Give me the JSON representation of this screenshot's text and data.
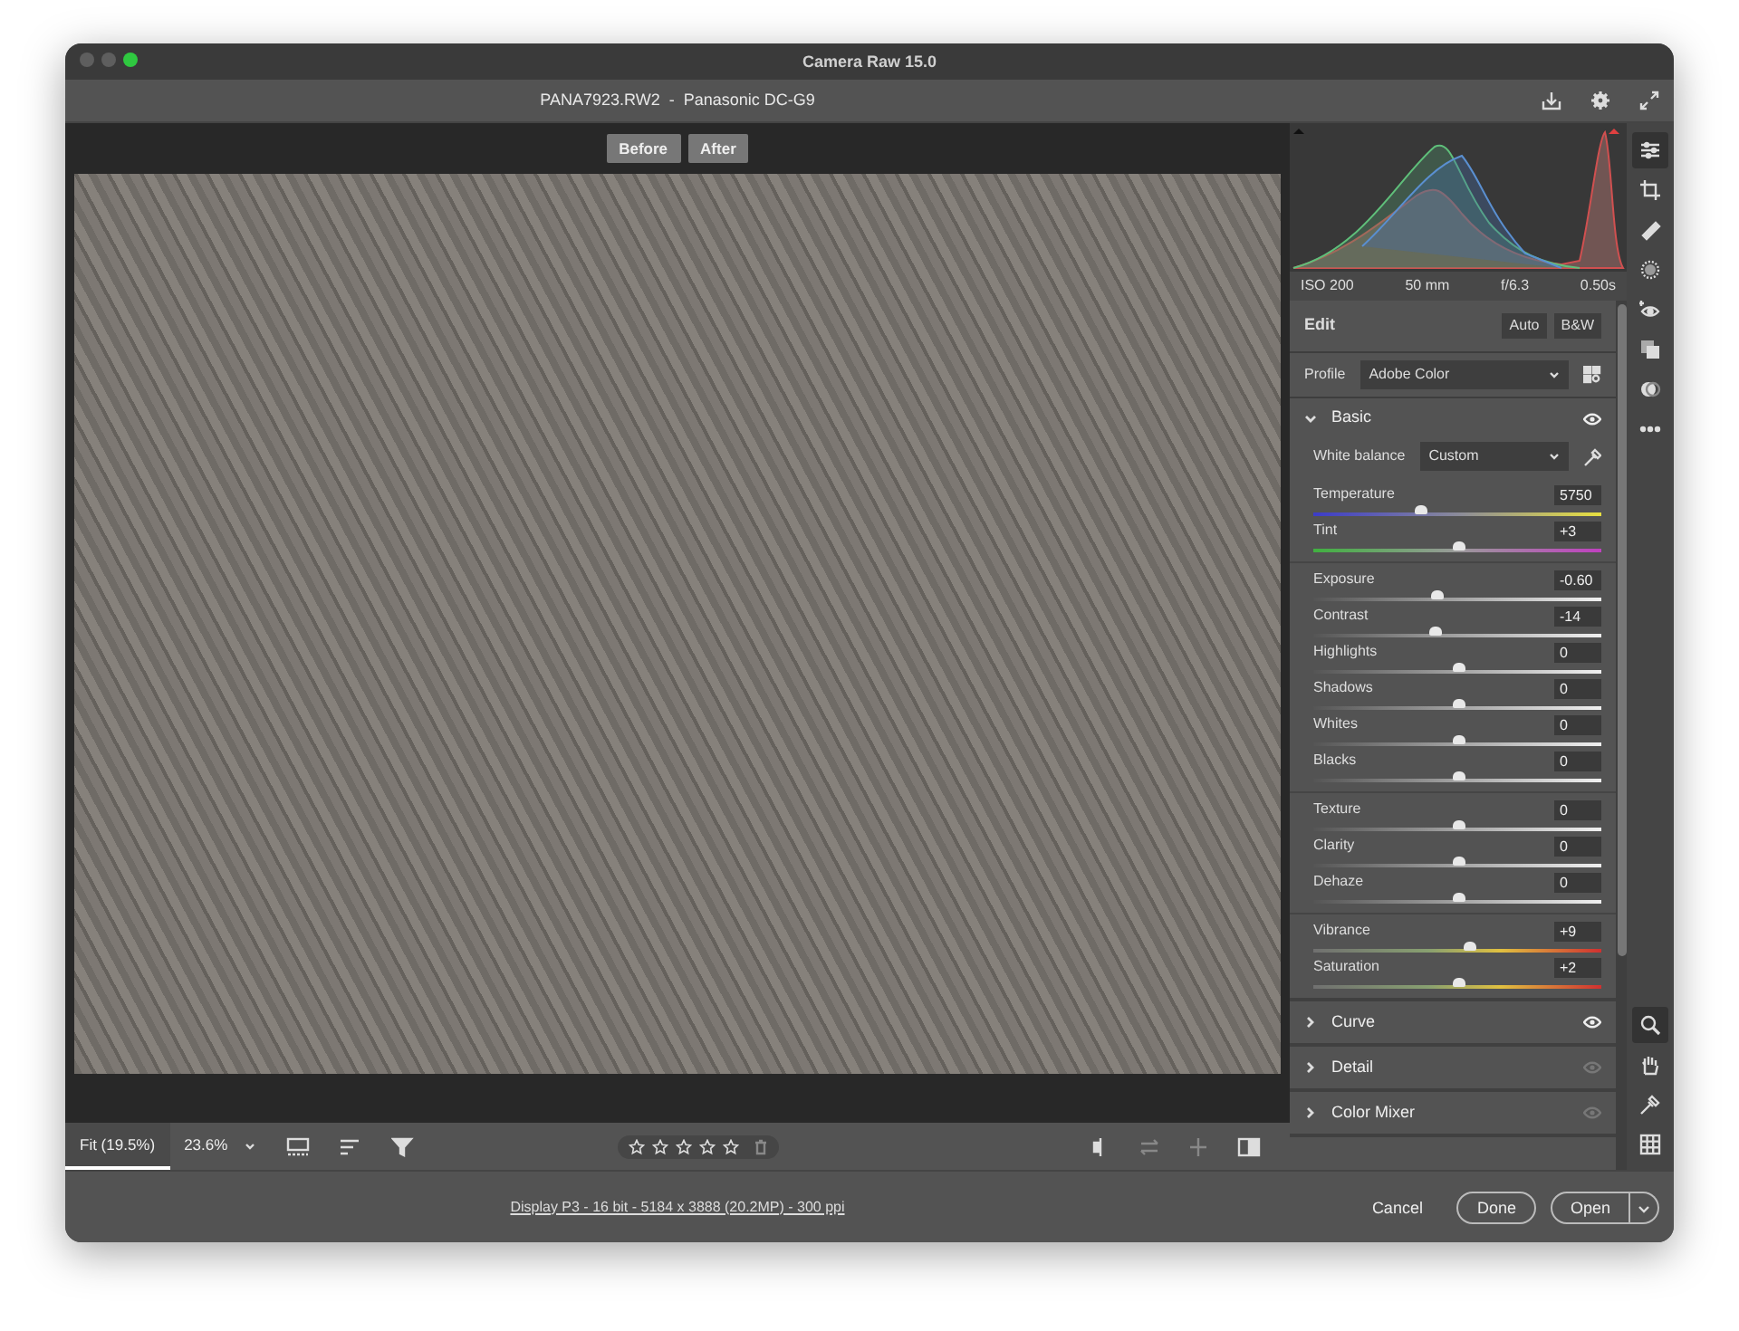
{
  "window": {
    "title": "Camera Raw 15.0"
  },
  "header": {
    "file": "PANA7923.RW2  -  Panasonic DC-G9"
  },
  "compare_buttons": [
    {
      "label": "Before"
    },
    {
      "label": "After"
    }
  ],
  "zoom_tabs": [
    {
      "label": "Fit (19.5%)",
      "selected": true
    },
    {
      "label": "23.6%",
      "selected": false
    }
  ],
  "rating": {
    "stars": 0
  },
  "histogram": {
    "info": [
      "ISO 200",
      "50 mm",
      "f/6.3",
      "0.50s"
    ]
  },
  "edit": {
    "title": "Edit",
    "buttons": [
      "Auto",
      "B&W"
    ]
  },
  "profile": {
    "label": "Profile",
    "value": "Adobe Color"
  },
  "basic": {
    "title": "Basic",
    "expanded": true,
    "active": true,
    "white_balance": {
      "label": "White balance",
      "value": "Custom"
    },
    "slider_groups": [
      [
        {
          "label": "Temperature",
          "value": "5750",
          "level": 0.37,
          "kind": "temperature"
        },
        {
          "label": "Tint",
          "value": "+3",
          "level": 0.5,
          "kind": "tint"
        }
      ],
      [
        {
          "label": "Exposure",
          "value": "-0.60",
          "level": 0.43,
          "kind": "tone"
        },
        {
          "label": "Contrast",
          "value": "-14",
          "level": 0.42,
          "kind": "tone"
        },
        {
          "label": "Highlights",
          "value": "0",
          "level": 0.5,
          "kind": "tone"
        },
        {
          "label": "Shadows",
          "value": "0",
          "level": 0.5,
          "kind": "tone"
        },
        {
          "label": "Whites",
          "value": "0",
          "level": 0.5,
          "kind": "tone"
        },
        {
          "label": "Blacks",
          "value": "0",
          "level": 0.5,
          "kind": "tone"
        }
      ],
      [
        {
          "label": "Texture",
          "value": "0",
          "level": 0.5,
          "kind": "tone"
        },
        {
          "label": "Clarity",
          "value": "0",
          "level": 0.5,
          "kind": "tone"
        },
        {
          "label": "Dehaze",
          "value": "0",
          "level": 0.5,
          "kind": "tone"
        }
      ],
      [
        {
          "label": "Vibrance",
          "value": "+9",
          "level": 0.54,
          "kind": "color"
        },
        {
          "label": "Saturation",
          "value": "+2",
          "level": 0.5,
          "kind": "color"
        }
      ]
    ]
  },
  "sections": [
    {
      "title": "Curve",
      "expanded": false,
      "active": true
    },
    {
      "title": "Detail",
      "expanded": false,
      "active": false
    },
    {
      "title": "Color Mixer",
      "expanded": false,
      "active": false
    }
  ],
  "tools": [
    {
      "kind": "edit",
      "selected": true
    },
    {
      "kind": "crop",
      "selected": false
    },
    {
      "kind": "heal",
      "selected": false
    },
    {
      "kind": "mask",
      "selected": false
    },
    {
      "kind": "redeye",
      "selected": false
    },
    {
      "kind": "presets",
      "selected": false
    },
    {
      "kind": "snapshots",
      "selected": false
    },
    {
      "kind": "more",
      "selected": false
    }
  ],
  "view_tools": [
    {
      "kind": "zoom",
      "selected": true
    },
    {
      "kind": "hand",
      "selected": false
    },
    {
      "kind": "sampler",
      "selected": false
    },
    {
      "kind": "grid",
      "selected": false
    }
  ],
  "footer": {
    "info_link": "Display P3 - 16 bit - 5184 x 3888 (20.2MP) - 300 ppi",
    "buttons": [
      "Cancel",
      "Done",
      "Open"
    ]
  }
}
